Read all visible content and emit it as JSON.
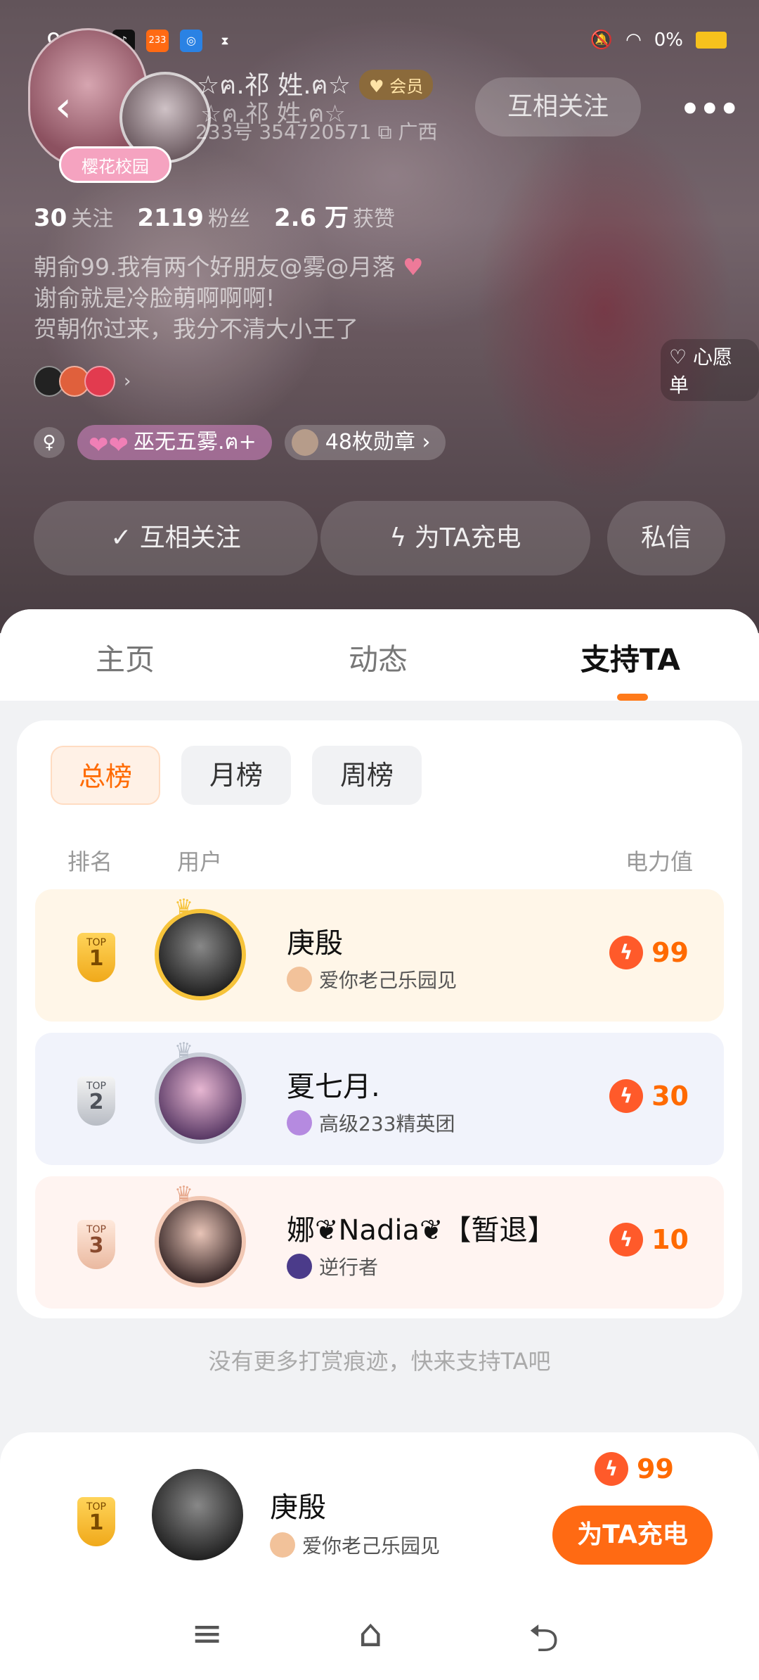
{
  "status_bar": {
    "time": "9:57",
    "app_icons": [
      "tiktok-icon",
      "233-icon",
      "wechat-icon",
      "hourglass-icon"
    ],
    "badge_233": "233",
    "battery_text": "0%"
  },
  "profile": {
    "name": "☆ฅ.祁 姓.ฅ☆",
    "name_secondary": "☆ฅ.祁 姓.ฅ☆",
    "vip_label": "会员",
    "id_text": "233号 354720571",
    "location": "广西",
    "avatar_badge": "樱花校园",
    "follow_top_label": "互相关注",
    "more_label": "•••",
    "stats": [
      {
        "num": "30",
        "label": "关注"
      },
      {
        "num": "2119",
        "label": "粉丝"
      },
      {
        "num": "2.6 万",
        "label": "获赞"
      }
    ],
    "bio": [
      "朝俞99.我有两个好朋友@雾@月落",
      "谢俞就是冷脸萌啊啊啊!",
      "贺朝你过来，我分不清大小王了"
    ],
    "wish_label": "心愿单",
    "tag_label": "巫无五雾.ฅ+",
    "medal_label": "48枚勋章",
    "actions": {
      "mutual": "✓ 互相关注",
      "charge": "为TA充电",
      "message": "私信"
    }
  },
  "tabs": [
    {
      "label": "主页"
    },
    {
      "label": "动态"
    },
    {
      "label": "支持TA"
    }
  ],
  "ranking": {
    "segments": [
      "总榜",
      "月榜",
      "周榜"
    ],
    "columns": {
      "rank": "排名",
      "user": "用户",
      "power": "电力值"
    },
    "rows": [
      {
        "top_label": "TOP",
        "rank": "1",
        "name": "庚殷",
        "sub": "爱你老己乐园见",
        "power": "99"
      },
      {
        "top_label": "TOP",
        "rank": "2",
        "name": "夏七月.",
        "sub": "高级233精英团",
        "power": "30"
      },
      {
        "top_label": "TOP",
        "rank": "3",
        "name": "娜❦Nadia❦【暂退】",
        "sub": "逆行者",
        "power": "10"
      }
    ],
    "no_more": "没有更多打赏痕迹，快来支持TA吧"
  },
  "bottom": {
    "top_label": "TOP",
    "rank": "1",
    "name": "庚殷",
    "sub": "爱你老己乐园见",
    "power": "99",
    "charge_button": "为TA充电"
  },
  "nav": {
    "menu": "≡",
    "home": "⌂",
    "back": "⮌"
  },
  "colors": {
    "accent": "#ff6a13",
    "gold": "#f6c33a"
  }
}
